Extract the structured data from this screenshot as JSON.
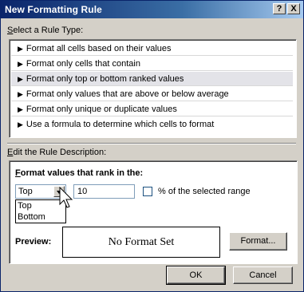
{
  "window": {
    "title": "New Formatting Rule",
    "help_label": "?",
    "close_label": "X"
  },
  "rule_type": {
    "heading_u": "S",
    "heading_rest": "elect a Rule Type:",
    "items": [
      {
        "label": "Format all cells based on their values",
        "selected": false
      },
      {
        "label": "Format only cells that contain",
        "selected": false
      },
      {
        "label": "Format only top or bottom ranked values",
        "selected": true
      },
      {
        "label": "Format only values that are above or below average",
        "selected": false
      },
      {
        "label": "Format only unique or duplicate values",
        "selected": false
      },
      {
        "label": "Use a formula to determine which cells to format",
        "selected": false
      }
    ]
  },
  "description": {
    "heading_u": "E",
    "heading_rest": "dit the Rule Description:",
    "rank_heading_u": "F",
    "rank_heading_rest": "ormat values that rank in the:",
    "rank_select": {
      "value": "Top",
      "options": [
        "Top",
        "Bottom"
      ]
    },
    "rank_count": "10",
    "percent_checkbox": {
      "checked": false,
      "label": "% of the selected range"
    },
    "preview_label": "Preview:",
    "preview_text": "No Format Set",
    "format_button": "Format..."
  },
  "buttons": {
    "ok": "OK",
    "cancel": "Cancel"
  },
  "colors": {
    "title_gradient_start": "#0a246a",
    "dialog_face": "#d4d0c8",
    "selected_row": "#e3e3e8"
  }
}
